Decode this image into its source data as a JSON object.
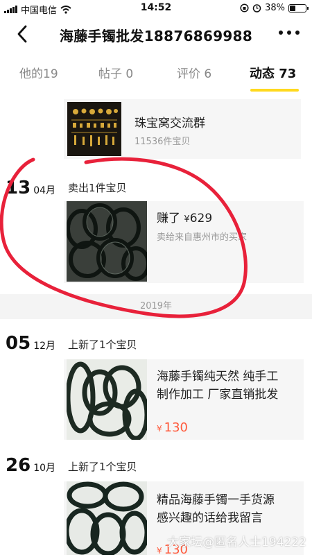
{
  "status_bar": {
    "carrier": "中国电信",
    "time": "14:52",
    "battery": "38%",
    "battery_level": 0.38
  },
  "header": {
    "title": "海藤手镯批发18876869988"
  },
  "tabs": [
    {
      "label": "他的19"
    },
    {
      "label": "帖子 0"
    },
    {
      "label": "评价 6"
    },
    {
      "label": "动态 73"
    }
  ],
  "group_card": {
    "title": "珠宝窝交流群",
    "count": "11536件宝贝"
  },
  "feed": [
    {
      "day": "13",
      "month": "04月",
      "action": "卖出1件宝贝",
      "title": "赚了",
      "price_symbol": "¥",
      "price": "629",
      "desc": "卖给来自惠州市的买家"
    },
    {
      "day": "05",
      "month": "12月",
      "action": "上新了1个宝贝",
      "line1": "海藤手镯纯天然 纯手工",
      "line2": "制作加工  厂家直销批发",
      "price_symbol": "¥",
      "price": "130"
    },
    {
      "day": "26",
      "month": "10月",
      "action": "上新了1个宝贝",
      "line1": "精品海藤手镯一手货源",
      "line2": "感兴趣的话给我留言",
      "price_symbol": "¥",
      "price": "130"
    }
  ],
  "year_divider": "2019年",
  "watermark": "大家坛@匿名人士194222",
  "colors": {
    "accent_yellow": "#ffd91f",
    "price_red": "#ff5a3c",
    "annotation_red": "#e8213a"
  }
}
